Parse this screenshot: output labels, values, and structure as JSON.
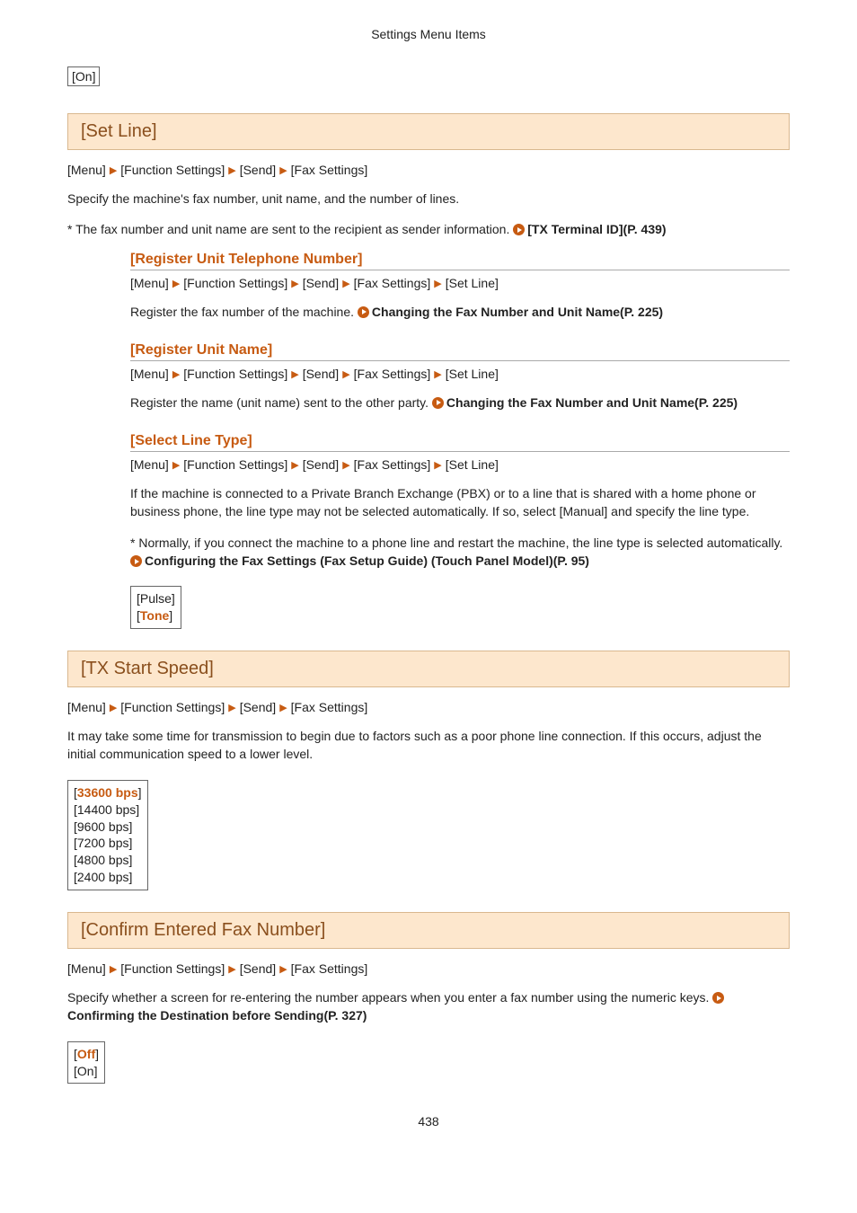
{
  "running_header": "Settings Menu Items",
  "page_number": "438",
  "top_box_option": "[On]",
  "sections": {
    "set_line": {
      "title": "[Set Line]",
      "breadcrumb": [
        "[Menu]",
        "[Function Settings]",
        "[Send]",
        "[Fax Settings]"
      ],
      "desc1": "Specify the machine's fax number, unit name, and the number of lines.",
      "desc2_prefix": "* The fax number and unit name are sent to the recipient as sender information. ",
      "desc2_link": "[TX Terminal ID](P. 439)",
      "sub": {
        "reg_tel": {
          "title": "[Register Unit Telephone Number]",
          "breadcrumb": [
            "[Menu]",
            "[Function Settings]",
            "[Send]",
            "[Fax Settings]",
            "[Set Line]"
          ],
          "desc_prefix": "Register the fax number of the machine. ",
          "desc_link": "Changing the Fax Number and Unit Name(P. 225)"
        },
        "reg_name": {
          "title": "[Register Unit Name]",
          "breadcrumb": [
            "[Menu]",
            "[Function Settings]",
            "[Send]",
            "[Fax Settings]",
            "[Set Line]"
          ],
          "desc_prefix": "Register the name (unit name) sent to the other party. ",
          "desc_link": "Changing the Fax Number and Unit Name(P. 225)"
        },
        "sel_line": {
          "title": "[Select Line Type]",
          "breadcrumb": [
            "[Menu]",
            "[Function Settings]",
            "[Send]",
            "[Fax Settings]",
            "[Set Line]"
          ],
          "p1": "If the machine is connected to a Private Branch Exchange (PBX) or to a line that is shared with a home phone or business phone, the line type may not be selected automatically. If so, select [Manual] and specify the line type.",
          "p2_prefix": "* Normally, if you connect the machine to a phone line and restart the machine, the line type is selected automatically. ",
          "p2_link": "Configuring the Fax Settings (Fax Setup Guide) (Touch Panel Model)(P. 95)",
          "opt_plain": "[Pulse]",
          "opt_default": "Tone"
        }
      }
    },
    "tx_speed": {
      "title": "[TX Start Speed]",
      "breadcrumb": [
        "[Menu]",
        "[Function Settings]",
        "[Send]",
        "[Fax Settings]"
      ],
      "desc": "It may take some time for transmission to begin due to factors such as a poor phone line connection. If this occurs, adjust the initial communication speed to a lower level.",
      "opt_default": "33600 bps",
      "opts": [
        "[14400 bps]",
        "[9600 bps]",
        "[7200 bps]",
        "[4800 bps]",
        "[2400 bps]"
      ]
    },
    "confirm_fax": {
      "title": "[Confirm Entered Fax Number]",
      "breadcrumb": [
        "[Menu]",
        "[Function Settings]",
        "[Send]",
        "[Fax Settings]"
      ],
      "desc_prefix": "Specify whether a screen for re-entering the number appears when you enter a fax number using the numeric keys. ",
      "desc_link": "Confirming the Destination before Sending(P. 327)",
      "opt_default": "Off",
      "opt_plain": "[On]"
    }
  }
}
